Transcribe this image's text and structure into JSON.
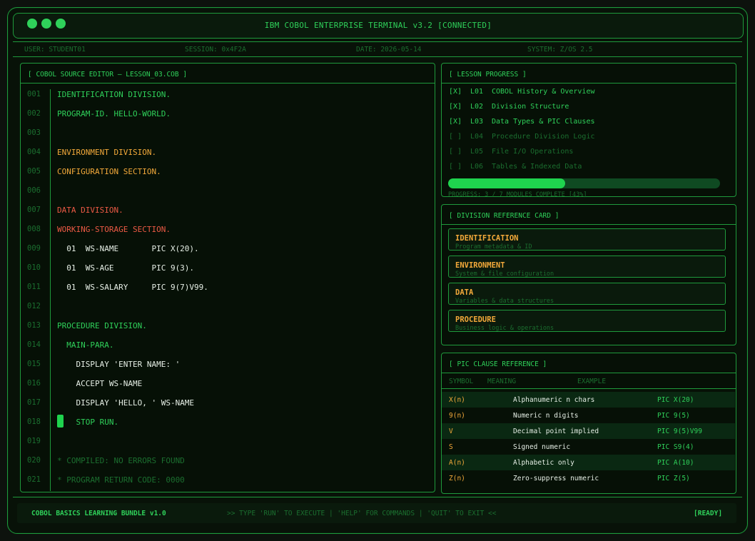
{
  "window": {
    "title": "IBM COBOL ENTERPRISE TERMINAL  v3.2  [CONNECTED]"
  },
  "status": {
    "user": "USER: STUDENT01",
    "session": "SESSION: 0x4F2A",
    "date": "DATE: 2026-05-14",
    "system": "SYSTEM: Z/OS 2.5"
  },
  "editor": {
    "title": "[ COBOL SOURCE EDITOR — LESSON_03.COB ]",
    "lines": [
      {
        "n": "001",
        "text": "IDENTIFICATION DIVISION.",
        "color": "green"
      },
      {
        "n": "002",
        "text": "PROGRAM-ID. HELLO-WORLD.",
        "color": "green"
      },
      {
        "n": "003",
        "text": "",
        "color": "green"
      },
      {
        "n": "004",
        "text": "ENVIRONMENT DIVISION.",
        "color": "orange"
      },
      {
        "n": "005",
        "text": "CONFIGURATION SECTION.",
        "color": "orange"
      },
      {
        "n": "006",
        "text": "",
        "color": "green"
      },
      {
        "n": "007",
        "text": "DATA DIVISION.",
        "color": "red"
      },
      {
        "n": "008",
        "text": "WORKING-STORAGE SECTION.",
        "color": "red"
      },
      {
        "n": "009",
        "text": "  01  WS-NAME       PIC X(20).",
        "color": "white"
      },
      {
        "n": "010",
        "text": "  01  WS-AGE        PIC 9(3).",
        "color": "white"
      },
      {
        "n": "011",
        "text": "  01  WS-SALARY     PIC 9(7)V99.",
        "color": "white"
      },
      {
        "n": "012",
        "text": "",
        "color": "green"
      },
      {
        "n": "013",
        "text": "PROCEDURE DIVISION.",
        "color": "green"
      },
      {
        "n": "014",
        "text": "  MAIN-PARA.",
        "color": "green"
      },
      {
        "n": "015",
        "text": "    DISPLAY 'ENTER NAME: '",
        "color": "white"
      },
      {
        "n": "016",
        "text": "    ACCEPT WS-NAME",
        "color": "white"
      },
      {
        "n": "017",
        "text": "    DISPLAY 'HELLO, ' WS-NAME",
        "color": "white"
      },
      {
        "n": "018",
        "text": "    STOP RUN.",
        "color": "green"
      },
      {
        "n": "019",
        "text": "",
        "color": "green"
      },
      {
        "n": "020",
        "text": "* COMPILED: NO ERRORS FOUND",
        "color": "dim"
      },
      {
        "n": "021",
        "text": "* PROGRAM RETURN CODE: 0000",
        "color": "dim"
      }
    ]
  },
  "progress": {
    "title": "[ LESSON PROGRESS ]",
    "lessons": [
      {
        "check": "[X]",
        "id": "L01",
        "name": "COBOL History & Overview",
        "done": true
      },
      {
        "check": "[X]",
        "id": "L02",
        "name": "Division Structure",
        "done": true
      },
      {
        "check": "[X]",
        "id": "L03",
        "name": "Data Types & PIC Clauses",
        "done": true
      },
      {
        "check": "[ ]",
        "id": "L04",
        "name": "Procedure Division Logic",
        "done": false
      },
      {
        "check": "[ ]",
        "id": "L05",
        "name": "File I/O Operations",
        "done": false
      },
      {
        "check": "[ ]",
        "id": "L06",
        "name": "Tables & Indexed Data",
        "done": false
      }
    ],
    "percent": 43,
    "summary": "PROGRESS: 3 / 7 MODULES COMPLETE  [43%]"
  },
  "divisions": {
    "title": "[ DIVISION REFERENCE CARD ]",
    "cards": [
      {
        "name": "IDENTIFICATION",
        "desc": "Program metadata & ID"
      },
      {
        "name": "ENVIRONMENT",
        "desc": "System & file configuration"
      },
      {
        "name": "DATA",
        "desc": "Variables & data structures"
      },
      {
        "name": "PROCEDURE",
        "desc": "Business logic & operations"
      }
    ]
  },
  "pic": {
    "title": "[ PIC CLAUSE REFERENCE ]",
    "headers": {
      "symbol": "SYMBOL",
      "meaning": "MEANING",
      "example": "EXAMPLE"
    },
    "rows": [
      {
        "symbol": "X(n)",
        "meaning": "Alphanumeric  n chars",
        "example": "PIC X(20)"
      },
      {
        "symbol": "9(n)",
        "meaning": "Numeric  n digits",
        "example": "PIC 9(5)"
      },
      {
        "symbol": "V",
        "meaning": "Decimal point implied",
        "example": "PIC 9(5)V99"
      },
      {
        "symbol": "S",
        "meaning": "Signed numeric",
        "example": "PIC S9(4)"
      },
      {
        "symbol": "A(n)",
        "meaning": "Alphabetic only",
        "example": "PIC A(10)"
      },
      {
        "symbol": "Z(n)",
        "meaning": "Zero-suppress numeric",
        "example": "PIC Z(5)"
      }
    ]
  },
  "footer": {
    "bundle": "COBOL BASICS LEARNING BUNDLE  v1.0",
    "hint": ">> TYPE 'RUN' TO EXECUTE  |  'HELP' FOR COMMANDS  |  'QUIT' TO EXIT <<",
    "state": "[READY]"
  }
}
